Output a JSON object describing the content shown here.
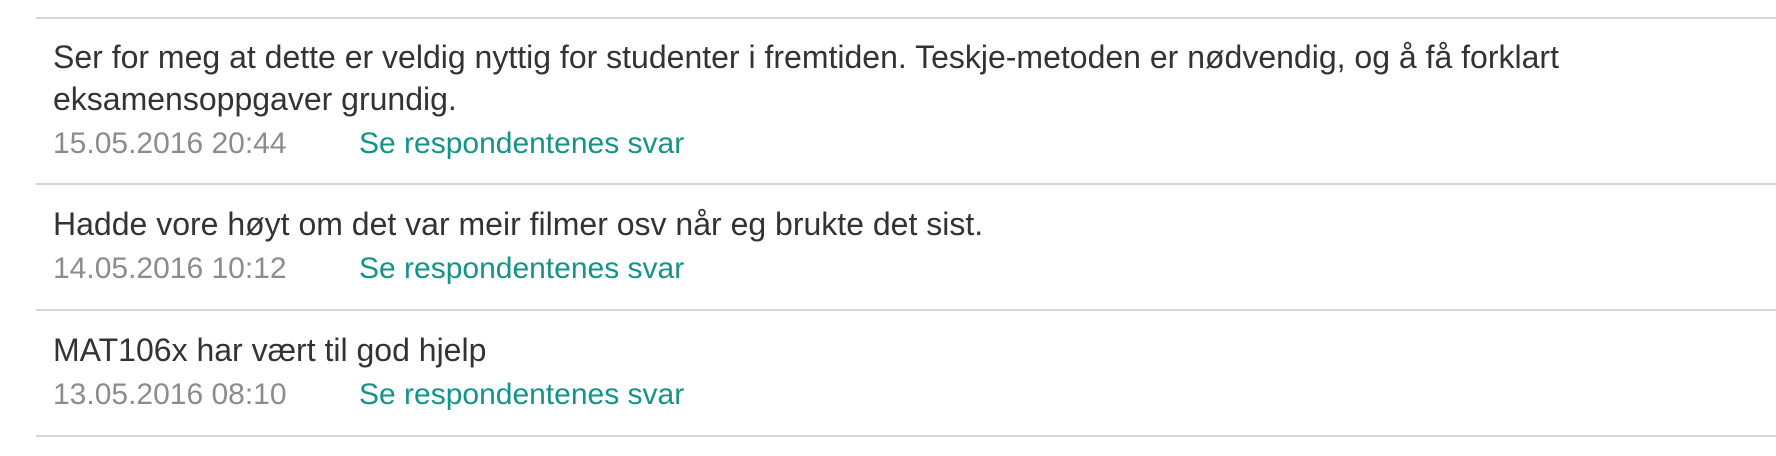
{
  "responses": [
    {
      "text": "Ser for meg at dette er veldig nyttig for studenter i fremtiden. Teskje-metoden er nødvendig, og å få forklart eksamensoppgaver grundig.",
      "timestamp": "15.05.2016 20:44",
      "link_label": "Se respondentenes svar"
    },
    {
      "text": "Hadde vore høyt om det var meir filmer osv når eg brukte det sist.",
      "timestamp": "14.05.2016 10:12",
      "link_label": "Se respondentenes svar"
    },
    {
      "text": "MAT106x har vært til god hjelp",
      "timestamp": "13.05.2016 08:10",
      "link_label": "Se respondentenes svar"
    }
  ]
}
